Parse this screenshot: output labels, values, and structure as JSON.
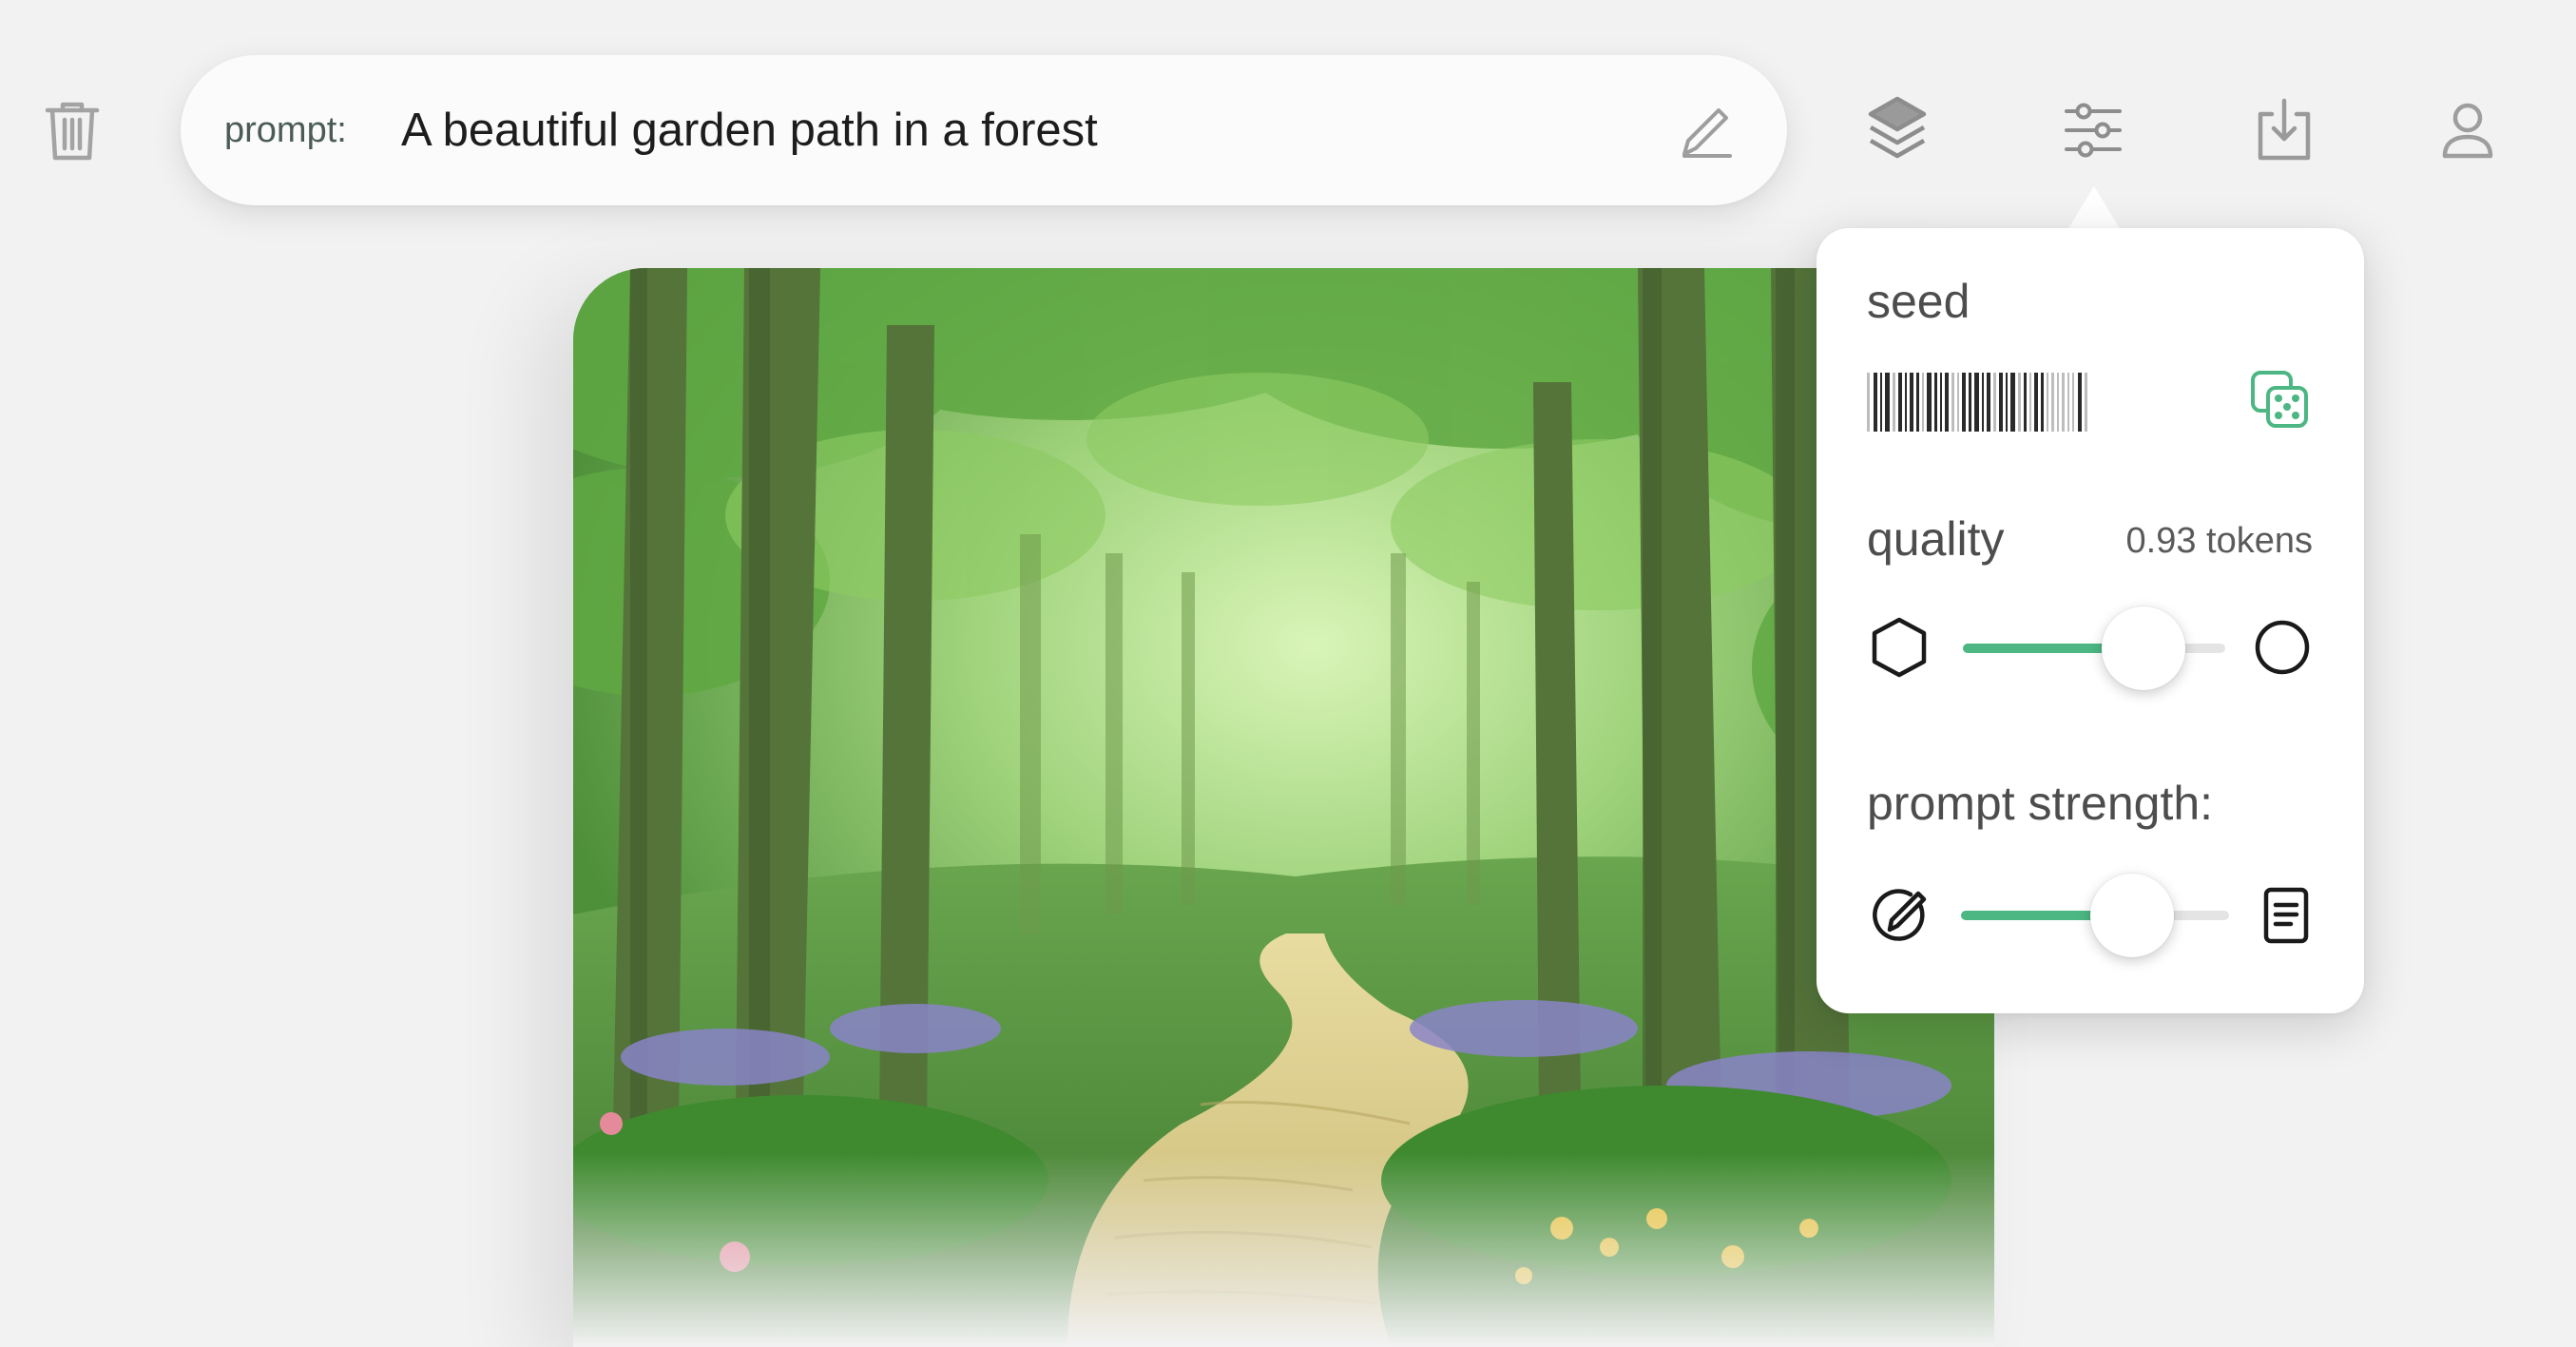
{
  "toolbar": {
    "icons": [
      "trash-icon",
      "layers-icon",
      "sliders-icon",
      "download-icon",
      "user-icon"
    ]
  },
  "prompt": {
    "label": "prompt:",
    "value": "A beautiful garden path in a forest"
  },
  "image": {
    "description_icon": "generated-image"
  },
  "settings": {
    "seed_label": "seed",
    "quality_label": "quality",
    "quality_value": "0.93 tokens",
    "quality_level": 0.69,
    "strength_label": "prompt strength:",
    "strength_level": 0.64
  },
  "colors": {
    "accent": "#4cb783",
    "icon_gray": "#9e9e9e"
  }
}
